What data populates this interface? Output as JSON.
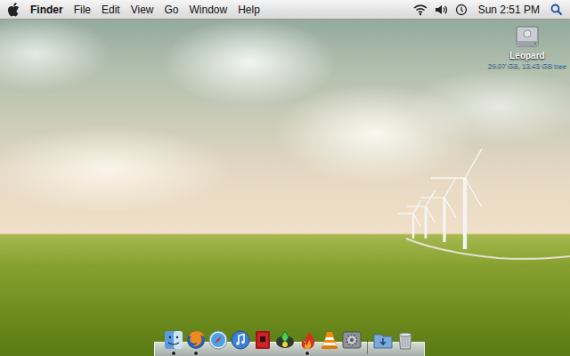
{
  "menubar": {
    "app": "Finder",
    "menus": [
      "File",
      "Edit",
      "View",
      "Go",
      "Window",
      "Help"
    ],
    "clock": "Sun 2:51 PM"
  },
  "desktop_icons": [
    {
      "label": "Leopard",
      "info": "29.07 GB, 13.43 GB free",
      "selected": false
    }
  ],
  "dock": {
    "items": [
      {
        "kind": "finder",
        "running": true
      },
      {
        "kind": "firefox",
        "running": true
      },
      {
        "kind": "safari",
        "running": false
      },
      {
        "kind": "itunes",
        "running": false
      },
      {
        "kind": "photobooth",
        "running": false
      },
      {
        "kind": "sims",
        "running": false
      },
      {
        "kind": "flame",
        "running": true
      },
      {
        "kind": "vlc",
        "running": false
      },
      {
        "kind": "preferences",
        "running": false
      },
      {
        "kind": "separator",
        "running": false
      },
      {
        "kind": "downloads",
        "running": false
      },
      {
        "kind": "trash",
        "running": false
      }
    ]
  }
}
